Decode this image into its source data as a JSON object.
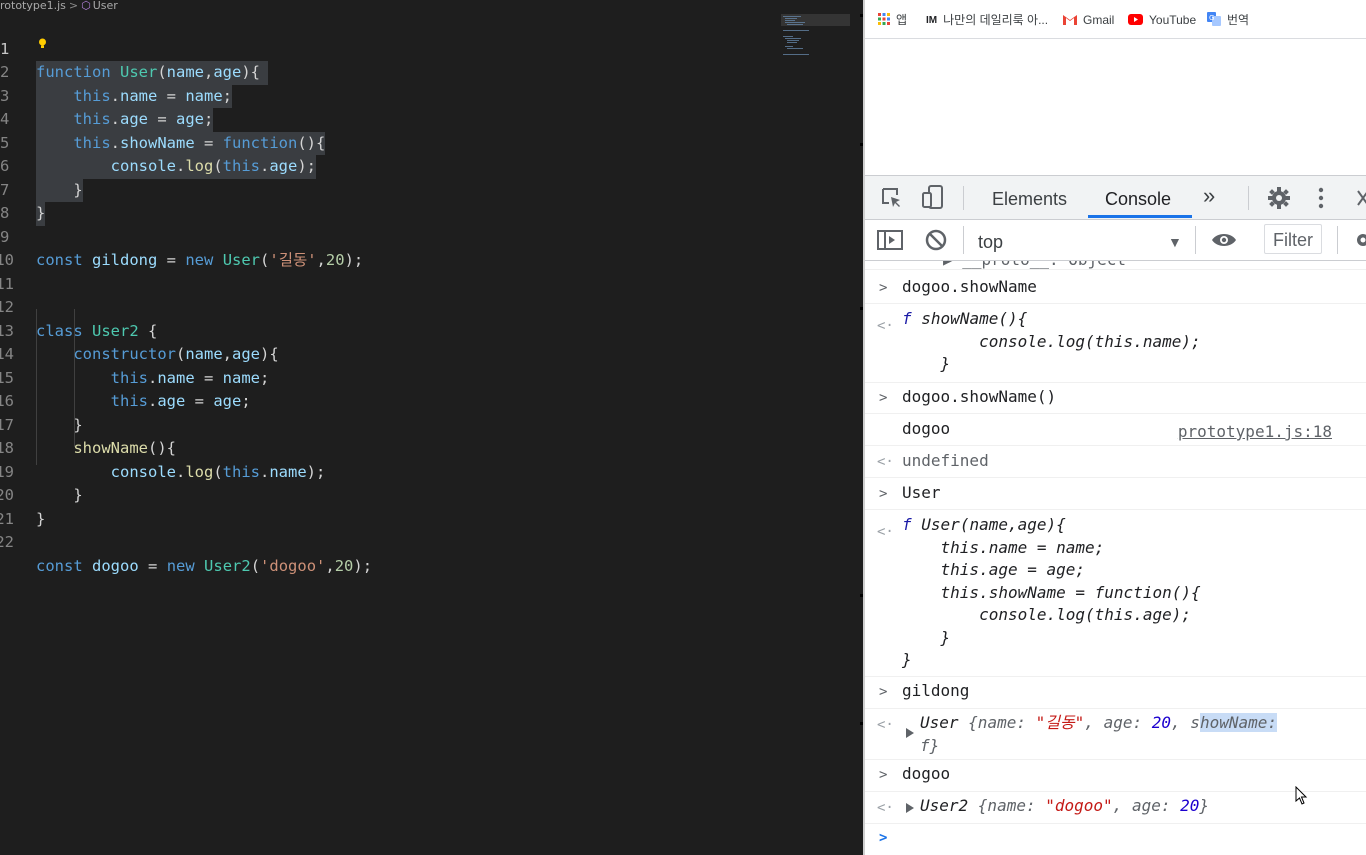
{
  "editor": {
    "breadcrumb": {
      "file": "rototype1.js",
      "separator": ">",
      "symbol": "User"
    },
    "code_lines": [
      {
        "n": "1",
        "text": "function User(name,age){"
      },
      {
        "n": "2",
        "text": "    this.name = name;"
      },
      {
        "n": "3",
        "text": "    this.age = age;"
      },
      {
        "n": "4",
        "text": "    this.showName = function(){"
      },
      {
        "n": "5",
        "text": "        console.log(this.age);"
      },
      {
        "n": "6",
        "text": "    }"
      },
      {
        "n": "7",
        "text": "}"
      },
      {
        "n": "8",
        "text": ""
      },
      {
        "n": "9",
        "text": "const gildong = new User('길동',20);"
      },
      {
        "n": "10",
        "text": ""
      },
      {
        "n": "11",
        "text": ""
      },
      {
        "n": "12",
        "text": "class User2 {"
      },
      {
        "n": "13",
        "text": "    constructor(name,age){"
      },
      {
        "n": "14",
        "text": "        this.name = name;"
      },
      {
        "n": "15",
        "text": "        this.age = age;"
      },
      {
        "n": "16",
        "text": "    }"
      },
      {
        "n": "17",
        "text": "    showName(){"
      },
      {
        "n": "18",
        "text": "        console.log(this.name);"
      },
      {
        "n": "19",
        "text": "    }"
      },
      {
        "n": "20",
        "text": "}"
      },
      {
        "n": "21",
        "text": ""
      },
      {
        "n": "22",
        "text": "const dogoo = new User2('dogoo',20);"
      }
    ]
  },
  "browser": {
    "bookmarks": [
      {
        "label": "앱",
        "icon": "apps-grid-icon"
      },
      {
        "label": "나만의 데일리룩 아...",
        "icon": "im-logo-icon"
      },
      {
        "label": "Gmail",
        "icon": "gmail-icon"
      },
      {
        "label": "YouTube",
        "icon": "youtube-icon"
      },
      {
        "label": "번역",
        "icon": "translate-icon"
      }
    ]
  },
  "devtools": {
    "tabs": {
      "elements": "Elements",
      "console": "Console",
      "more": "»"
    },
    "toolbar": {
      "context": "top",
      "filter_placeholder": "Filter"
    },
    "console": {
      "partial_top": "▶ __proto__: Object",
      "entries": {
        "in1": "dogoo.showName",
        "out1_l1": "showName(){",
        "out1_l2": "        console.log(this.name);",
        "out1_l3": "    }",
        "in2": "dogoo.showName()",
        "log2": "dogoo",
        "log2_src": "prototype1.js:18",
        "out2": "undefined",
        "in3": "User",
        "out3_l1": "User(name,age){",
        "out3_l2": "    this.name = name;",
        "out3_l3": "    this.age = age;",
        "out3_l4": "    this.showName = function(){",
        "out3_l5": "        console.log(this.age);",
        "out3_l6": "    }",
        "out3_l7": "}",
        "in4": "gildong",
        "out4_cls": "User ",
        "out4_open": "{name: ",
        "out4_name": "\"길동\"",
        "out4_mid": ", age: ",
        "out4_age": "20",
        "out4_sep": ", s",
        "out4_hl": "howName:",
        "out4_l2": "f}",
        "in5": "dogoo",
        "out5_cls": "User2 ",
        "out5_open": "{name: ",
        "out5_name": "\"dogoo\"",
        "out5_mid": ", age: ",
        "out5_age": "20",
        "out5_close": "}",
        "f_glyph": "f"
      }
    }
  }
}
